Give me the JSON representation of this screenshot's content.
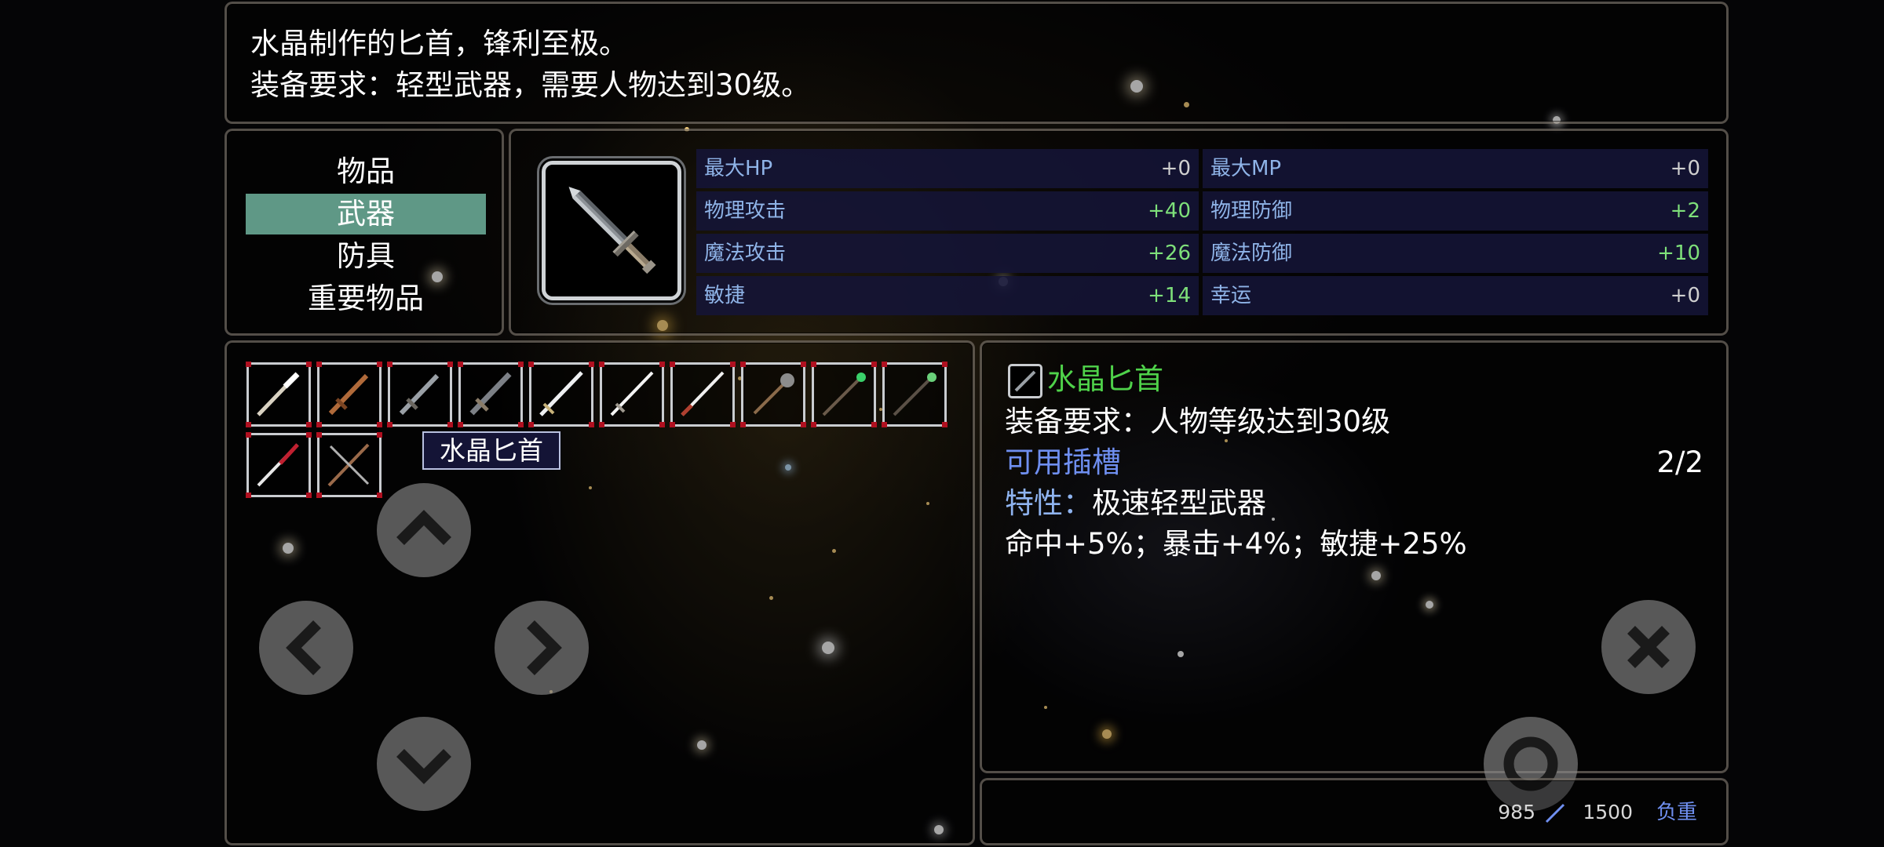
{
  "help": {
    "line1": "水晶制作的匕首，锋利至极。",
    "line2": "装备要求：轻型武器，需要人物达到30级。"
  },
  "categories": [
    {
      "label": "物品"
    },
    {
      "label": "武器",
      "selected": true
    },
    {
      "label": "防具"
    },
    {
      "label": "重要物品"
    }
  ],
  "stats": [
    {
      "name": "最大HP",
      "value": "+0",
      "color": "#cfcfcf"
    },
    {
      "name": "最大MP",
      "value": "+0",
      "color": "#cfcfcf"
    },
    {
      "name": "物理攻击",
      "value": "+40",
      "color": "#7ee07a"
    },
    {
      "name": "物理防御",
      "value": "+2",
      "color": "#7ee07a"
    },
    {
      "name": "魔法攻击",
      "value": "+26",
      "color": "#7ee07a"
    },
    {
      "name": "魔法防御",
      "value": "+10",
      "color": "#7ee07a"
    },
    {
      "name": "敏捷",
      "value": "+14",
      "color": "#7ee07a"
    },
    {
      "name": "幸运",
      "value": "+0",
      "color": "#cfcfcf"
    }
  ],
  "inventory": {
    "items": [
      {
        "icon": "spear-icon"
      },
      {
        "icon": "bronze-dagger-icon"
      },
      {
        "icon": "crystal-dagger-icon"
      },
      {
        "icon": "iron-sword-icon"
      },
      {
        "icon": "silver-sword-icon"
      },
      {
        "icon": "long-sword-icon"
      },
      {
        "icon": "katana-icon"
      },
      {
        "icon": "mace-icon"
      },
      {
        "icon": "emerald-staff-icon"
      },
      {
        "icon": "jade-staff-icon"
      },
      {
        "icon": "red-spear-icon"
      },
      {
        "icon": "crossed-blades-icon"
      }
    ],
    "tooltip": "水晶匕首"
  },
  "detail": {
    "name": "水晶匕首",
    "requirement": "装备要求：人物等级达到30级",
    "slots_label": "可用插槽",
    "slots_value": "2/2",
    "trait_label": "特性：",
    "trait_value": "极速轻型武器",
    "bonuses": "命中+5%；暴击+4%；敏捷+25%"
  },
  "footer": {
    "weight_current": "985",
    "weight_max": "1500",
    "weight_label": "负重"
  },
  "colors": {
    "selected_category": "#5f9886",
    "item_name": "#4fd24a",
    "slots_label": "#6f8ff0",
    "trait_label": "#8fb4f0",
    "weight_label": "#6f8ff0"
  }
}
